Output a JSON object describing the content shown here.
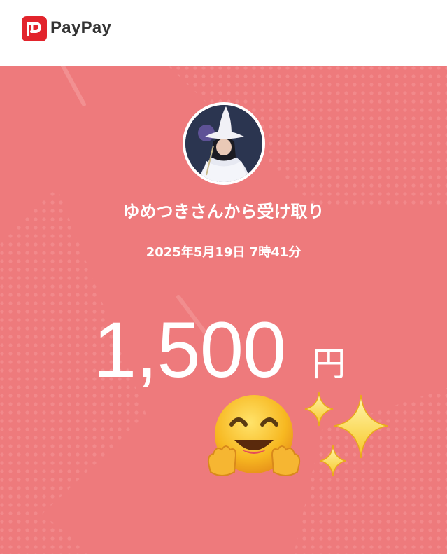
{
  "header": {
    "brand_name": "PayPay",
    "logo_icon": "paypay-logo-icon",
    "brand_color": "#e2242c"
  },
  "receipt": {
    "background_color": "#ee7a7c",
    "sender_text": "ゆめつきさんから受け取り",
    "datetime": "2025年5月19日 7時41分",
    "amount": "1,500",
    "currency": "円",
    "avatar_icon": "user-avatar",
    "stickers": [
      "hugging-face-emoji",
      "sparkles-emoji"
    ]
  }
}
